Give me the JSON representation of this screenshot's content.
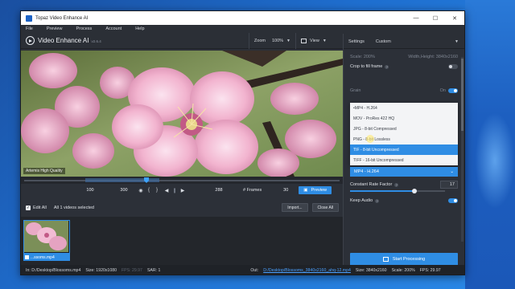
{
  "window": {
    "title": "Topaz Video Enhance AI"
  },
  "menu": [
    "File",
    "Preview",
    "Process",
    "Account",
    "Help"
  ],
  "toolbar": {
    "brand": "Video Enhance AI",
    "version": "v2.6.4",
    "zoom_label": "Zoom",
    "zoom_value": "100%",
    "view_label": "View"
  },
  "settings": {
    "label": "Settings",
    "preset": "Custom",
    "scale": "Scale: 200%",
    "width_height": "Width,Height: 3840x2160",
    "crop_label": "Crop to fill frame",
    "partial_label": "Grain",
    "partial_value": "On",
    "format_options": [
      "•MP4 - H.264",
      "MOV - ProRes 422 HQ",
      "JPG - 8-bit Compressed",
      "PNG - 8-bit Lossless",
      "TIF - 8-bit Uncompressed",
      "TIFF - 16-bit Uncompressed"
    ],
    "format_selected": "MP4 - H.264",
    "crf_label": "Constant Rate Factor",
    "crf_value": "17",
    "crf_level": 0.68,
    "keep_audio_label": "Keep Audio",
    "start_label": "Start Processing"
  },
  "viewer": {
    "model_tag": "Artemis High Quality"
  },
  "transport": {
    "start_frame": "100",
    "end_frame": "300",
    "frame_count": "288",
    "frames_label": "# Frames",
    "frames_value": "30",
    "preview_label": "Preview"
  },
  "selection": {
    "edit_all": "Edit All",
    "summary": "All 1 videos selected",
    "import": "Import...",
    "close_all": "Close All"
  },
  "thumb": {
    "label": "...ssoms.mp4"
  },
  "status": {
    "in_path": "In: D:/Desktop/Blossoms.mp4",
    "in_size": "Size: 1920x1080",
    "fps_dim": "FPS: 29.97",
    "sar": "SAR: 1",
    "out_label": "Out:",
    "out_path": "D:/Desktop/Blossoms_3840x2160_ahq-12.mp4",
    "out_size": "Size: 3840x2160",
    "out_scale": "Scale: 200%",
    "out_fps": "FPS: 29.97"
  },
  "colors": {
    "accent": "#2f8de4",
    "bg": "#2c3038",
    "desktop": "#1f6fd0"
  }
}
